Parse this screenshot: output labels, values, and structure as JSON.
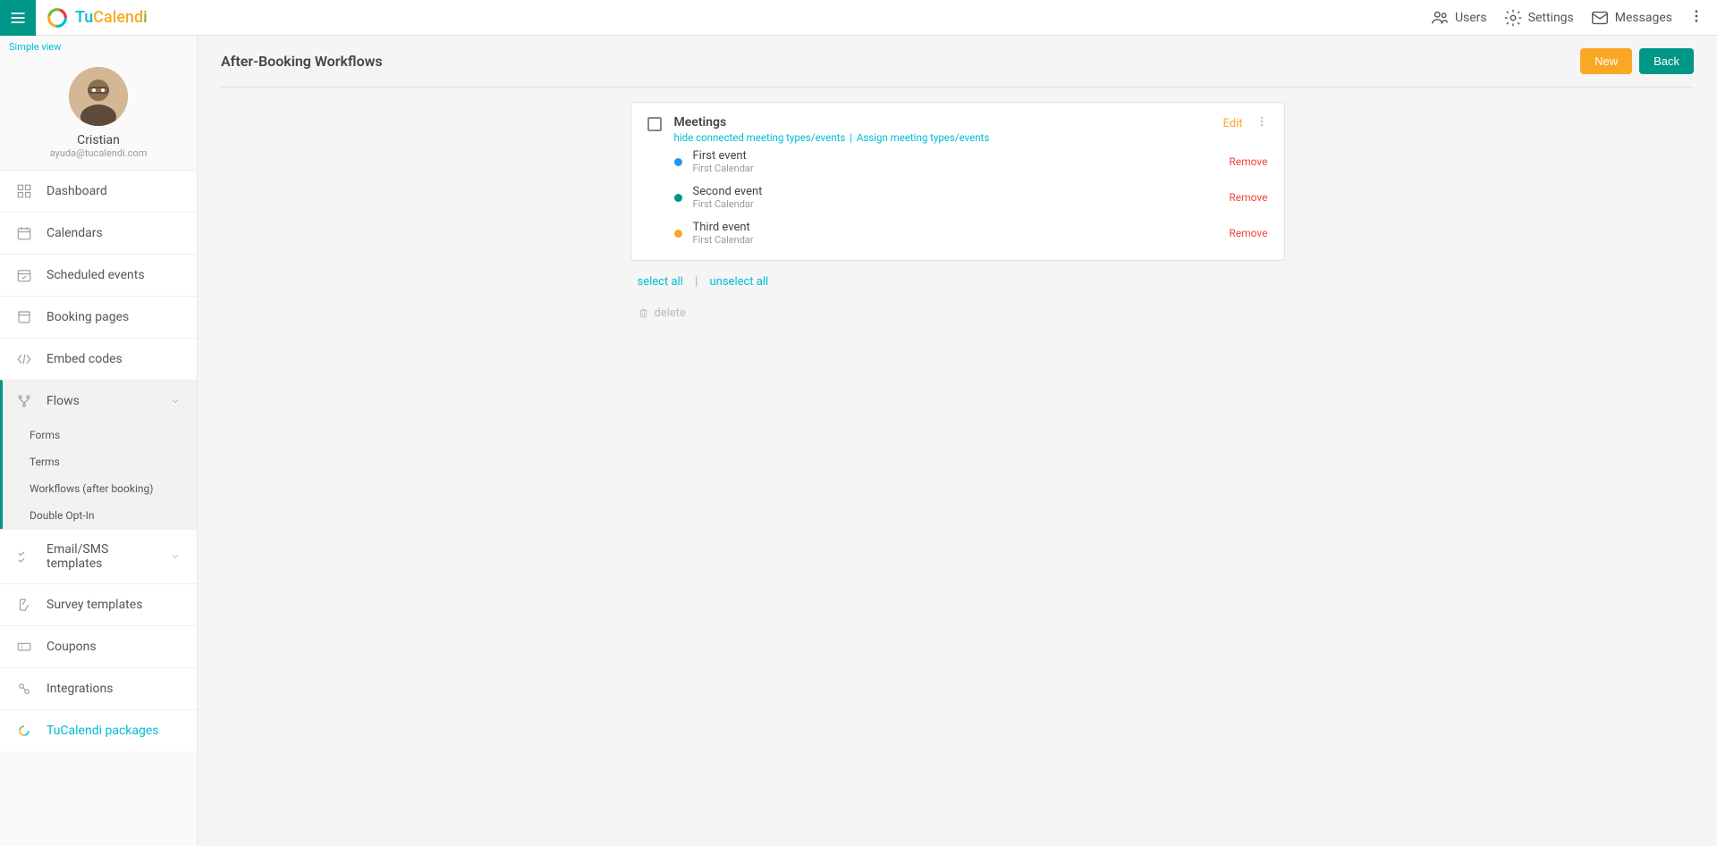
{
  "header": {
    "logo_tu": "Tu",
    "logo_calend": "Calend",
    "logo_i": "i",
    "users": "Users",
    "settings": "Settings",
    "messages": "Messages"
  },
  "sidebar": {
    "simple_view": "Simple view",
    "profile": {
      "name": "Cristian",
      "email": "ayuda@tucalendi.com"
    },
    "items": {
      "dashboard": "Dashboard",
      "calendars": "Calendars",
      "scheduled": "Scheduled events",
      "booking": "Booking pages",
      "embed": "Embed codes",
      "flows": "Flows",
      "email_sms": "Email/SMS templates",
      "survey": "Survey templates",
      "coupons": "Coupons",
      "integrations": "Integrations",
      "packages": "TuCalendi packages"
    },
    "sub": {
      "forms": "Forms",
      "terms": "Terms",
      "workflows": "Workflows (after booking)",
      "double_opt": "Double Opt-In"
    }
  },
  "page": {
    "title": "After-Booking Workflows",
    "new_btn": "New",
    "back_btn": "Back"
  },
  "card": {
    "title": "Meetings",
    "hide_link": "hide connected meeting types/events",
    "assign_link": "Assign meeting types/events",
    "edit": "Edit",
    "events": [
      {
        "name": "First event",
        "calendar": "First Calendar",
        "color": "#2196f3",
        "remove": "Remove"
      },
      {
        "name": "Second event",
        "calendar": "First Calendar",
        "color": "#009688",
        "remove": "Remove"
      },
      {
        "name": "Third event",
        "calendar": "First Calendar",
        "color": "#f9a825",
        "remove": "Remove"
      }
    ]
  },
  "actions": {
    "select_all": "select all",
    "unselect_all": "unselect all",
    "delete": "delete"
  }
}
